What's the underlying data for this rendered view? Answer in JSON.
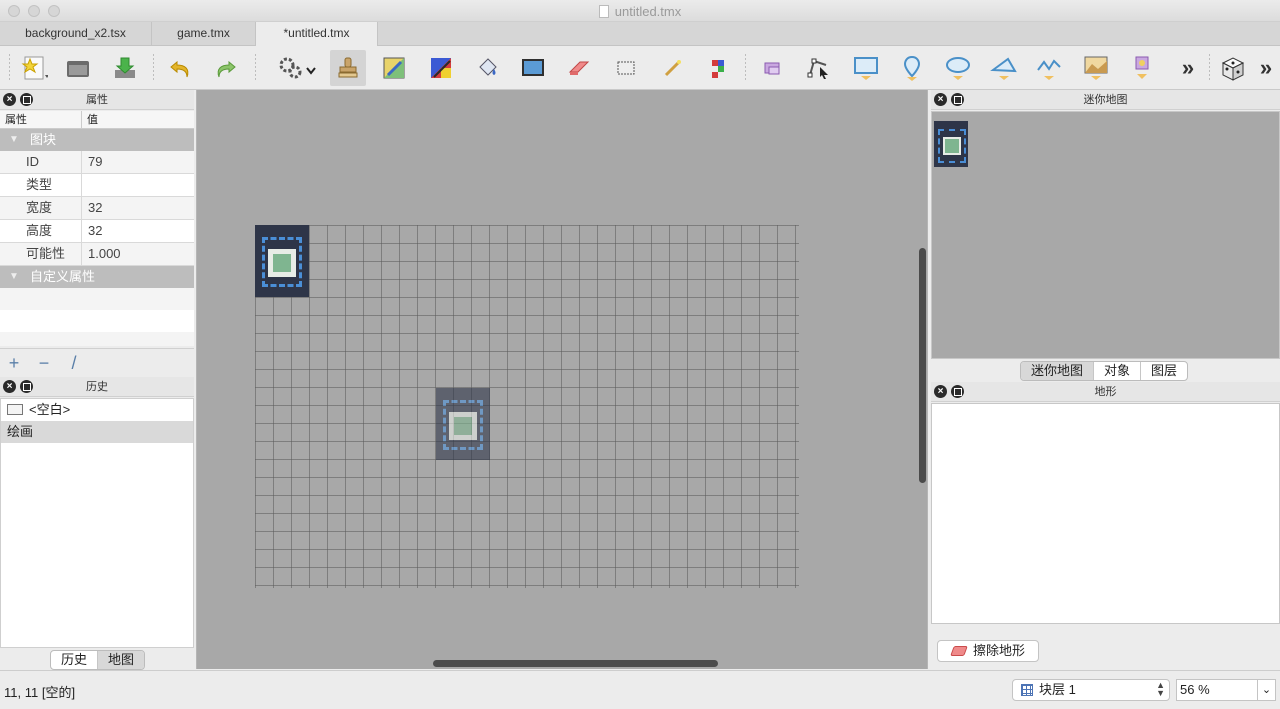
{
  "window": {
    "title": "untitled.tmx"
  },
  "tabs": [
    {
      "label": "background_x2.tsx"
    },
    {
      "label": "game.tmx"
    },
    {
      "label": "*untitled.tmx"
    }
  ],
  "toolbar": {
    "tools": [
      {
        "name": "new-map",
        "icon": "new-document-icon"
      },
      {
        "name": "open",
        "icon": "folder-icon"
      },
      {
        "name": "save",
        "icon": "save-download-icon"
      },
      {
        "name": "undo",
        "icon": "undo-icon"
      },
      {
        "name": "redo",
        "icon": "redo-icon"
      },
      {
        "name": "commands",
        "icon": "gears-icon"
      },
      {
        "name": "stamp-brush",
        "icon": "stamp-icon"
      },
      {
        "name": "terrain-brush",
        "icon": "terrain-brush-icon"
      },
      {
        "name": "wang-brush",
        "icon": "wang-brush-icon"
      },
      {
        "name": "bucket-fill",
        "icon": "bucket-fill-icon"
      },
      {
        "name": "shape-fill",
        "icon": "shape-fill-icon"
      },
      {
        "name": "eraser",
        "icon": "eraser-icon"
      },
      {
        "name": "rect-select",
        "icon": "rectangle-select-icon"
      },
      {
        "name": "magic-wand",
        "icon": "magic-wand-icon"
      },
      {
        "name": "select-same-tile",
        "icon": "select-same-tile-icon"
      },
      {
        "name": "select-objects",
        "icon": "select-objects-icon"
      },
      {
        "name": "edit-polygons",
        "icon": "edit-polygons-icon"
      },
      {
        "name": "insert-rectangle",
        "icon": "insert-rectangle-icon"
      },
      {
        "name": "insert-point",
        "icon": "insert-point-icon"
      },
      {
        "name": "insert-ellipse",
        "icon": "insert-ellipse-icon"
      },
      {
        "name": "insert-polygon",
        "icon": "insert-polygon-icon"
      },
      {
        "name": "insert-polyline",
        "icon": "insert-polyline-icon"
      },
      {
        "name": "insert-tile",
        "icon": "insert-tile-icon"
      },
      {
        "name": "insert-template",
        "icon": "insert-template-icon"
      },
      {
        "name": "more",
        "icon": "double-chevron-icon",
        "label": "»"
      },
      {
        "name": "random-mode",
        "icon": "dice-icon"
      },
      {
        "name": "more-right",
        "icon": "double-chevron-icon",
        "label": "»"
      }
    ]
  },
  "properties_panel": {
    "title": "属性",
    "col_name": "属性",
    "col_value": "值",
    "group_tile": "图块",
    "rows": [
      {
        "key": "ID",
        "value": "79"
      },
      {
        "key": "类型",
        "value": ""
      },
      {
        "key": "宽度",
        "value": "32"
      },
      {
        "key": "高度",
        "value": "32"
      },
      {
        "key": "可能性",
        "value": "1.000"
      }
    ],
    "group_custom": "自定义属性",
    "add": "+",
    "remove": "−",
    "rename": "/"
  },
  "history_panel": {
    "title": "历史",
    "items": [
      {
        "label": "<空白>"
      },
      {
        "label": "绘画"
      }
    ],
    "tabs": [
      "历史",
      "地图"
    ]
  },
  "minimap_panel": {
    "title": "迷你地图",
    "tabs": [
      "迷你地图",
      "对象",
      "图层"
    ]
  },
  "terrain_panel": {
    "title": "地形",
    "erase_label": "擦除地形"
  },
  "statusbar": {
    "coords": "11, 11 [空的]",
    "layer": "块层 1",
    "zoom": "56 %"
  },
  "colors": {
    "canvas_bg": "#a8a8a8",
    "tile_bg": "#2e3548",
    "tile_frame": "#4a8ed6",
    "tile_center": "#7fb590"
  }
}
